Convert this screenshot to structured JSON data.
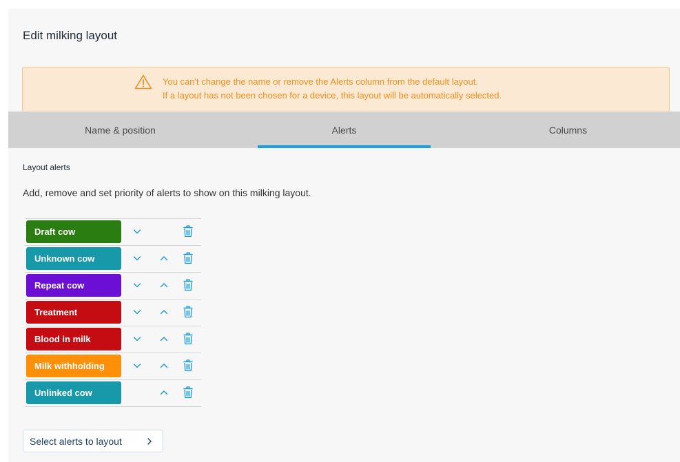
{
  "page": {
    "title": "Edit milking layout"
  },
  "warning": {
    "icon": "warning-triangle-icon",
    "line1": "You can't change the name or remove the Alerts column from the default layout.",
    "line2": "If a layout has not been chosen for a device, this layout will be automatically selected."
  },
  "tabs": [
    {
      "label": "Name & position",
      "active": false
    },
    {
      "label": "Alerts",
      "active": true
    },
    {
      "label": "Columns",
      "active": false
    }
  ],
  "section": {
    "label": "Layout alerts",
    "description": "Add, remove and set priority of alerts to show on this milking layout."
  },
  "alerts": [
    {
      "label": "Draft cow",
      "color": "#2a7d10",
      "down": true,
      "up": false
    },
    {
      "label": "Unknown cow",
      "color": "#1799a9",
      "down": true,
      "up": true
    },
    {
      "label": "Repeat cow",
      "color": "#6b0fd4",
      "down": true,
      "up": true
    },
    {
      "label": "Treatment",
      "color": "#c40c12",
      "down": true,
      "up": true
    },
    {
      "label": "Blood in milk",
      "color": "#c40c12",
      "down": true,
      "up": true
    },
    {
      "label": "Milk withholding",
      "color": "#fd9008",
      "down": true,
      "up": true
    },
    {
      "label": "Unlinked cow",
      "color": "#1799a9",
      "down": false,
      "up": true
    }
  ],
  "icons": {
    "down": "chevron-down-icon",
    "up": "chevron-up-icon",
    "delete": "trash-icon"
  },
  "colors": {
    "accent": "#1a9fe0",
    "control": "#1799d6",
    "warning_text": "#ef8f1e",
    "warning_bg": "#fbe9d3"
  },
  "footer": {
    "select_button_label": "Select alerts to layout"
  }
}
